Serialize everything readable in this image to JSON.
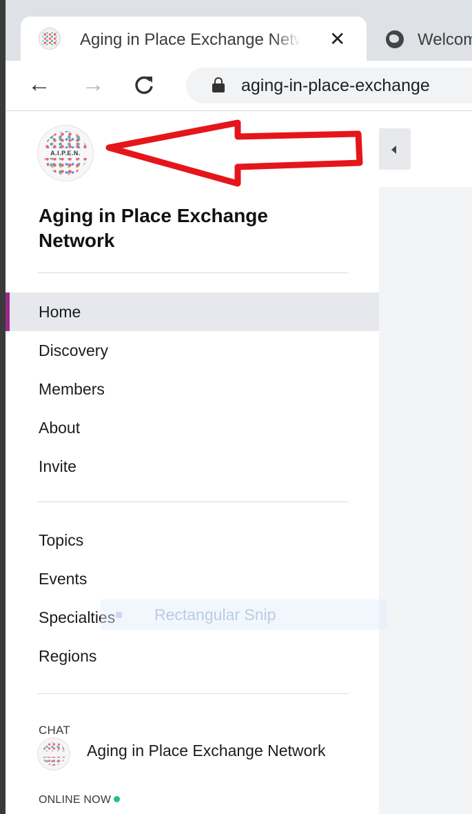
{
  "browser": {
    "active_tab": {
      "title": "Aging in Place Exchange Network",
      "favicon": "aipen-logo-icon"
    },
    "inactive_tab": {
      "title": "Welcome",
      "favicon": "globe-icon"
    },
    "toolbar": {
      "back": "←",
      "forward": "→",
      "reload": "C",
      "url": "aging-in-place-exchange"
    }
  },
  "sidebar": {
    "logo_text": "A.I.P.E.N.",
    "community_name": "Aging in Place Exchange Network",
    "nav_primary": [
      {
        "label": "Home",
        "active": true
      },
      {
        "label": "Discovery",
        "active": false
      },
      {
        "label": "Members",
        "active": false
      },
      {
        "label": "About",
        "active": false
      },
      {
        "label": "Invite",
        "active": false
      }
    ],
    "nav_secondary": [
      {
        "label": "Topics"
      },
      {
        "label": "Events"
      },
      {
        "label": "Specialties"
      },
      {
        "label": "Regions"
      }
    ],
    "chat": {
      "heading": "CHAT",
      "channel_name": "Aging in Place Exchange Network",
      "online_label": "ONLINE NOW"
    }
  },
  "overlay": {
    "snip_label": "Rectangular Snip"
  },
  "colors": {
    "active_accent": "#9b2a86",
    "annotation_arrow": "#e4161b",
    "online_dot": "#22c27a"
  }
}
